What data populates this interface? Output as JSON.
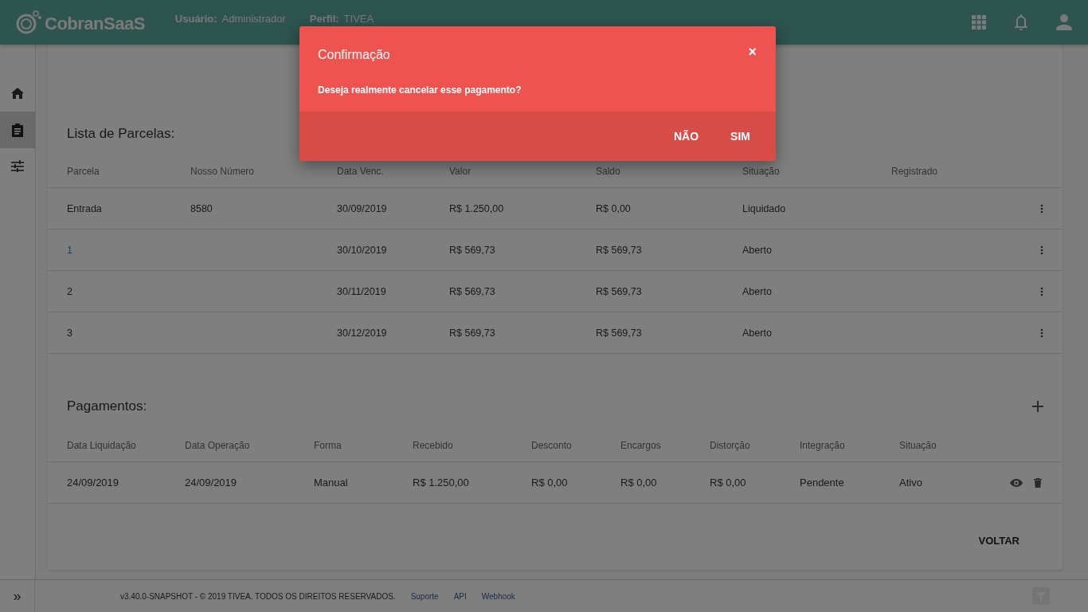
{
  "header": {
    "brand": "CobranSaaS",
    "user_label": "Usuário:",
    "user_value": "Administrador",
    "profile_label": "Perfil:",
    "profile_value": "TIVEA"
  },
  "sidebar": {
    "items": [
      {
        "selected": false
      },
      {
        "selected": true
      },
      {
        "selected": false
      }
    ]
  },
  "installments": {
    "title": "Lista de Parcelas:",
    "columns": [
      "Parcela",
      "Nosso Número",
      "Data Venc.",
      "Valor",
      "Saldo",
      "Situação",
      "Registrado"
    ],
    "rows": [
      {
        "link": false,
        "cells": [
          "Entrada",
          "8580",
          "30/09/2019",
          "R$ 1.250,00",
          "R$ 0,00",
          "Liquidado",
          ""
        ]
      },
      {
        "link": true,
        "cells": [
          "1",
          "",
          "30/10/2019",
          "R$ 569,73",
          "R$ 569,73",
          "Aberto",
          ""
        ]
      },
      {
        "link": false,
        "cells": [
          "2",
          "",
          "30/11/2019",
          "R$ 569,73",
          "R$ 569,73",
          "Aberto",
          ""
        ]
      },
      {
        "link": false,
        "cells": [
          "3",
          "",
          "30/12/2019",
          "R$ 569,73",
          "R$ 569,73",
          "Aberto",
          ""
        ]
      }
    ]
  },
  "payments": {
    "title": "Pagamentos:",
    "columns": [
      "Data Liquidação",
      "Data Operação",
      "Forma",
      "Recebido",
      "Desconto",
      "Encargos",
      "Distorção",
      "Integração",
      "Situação"
    ],
    "rows": [
      {
        "cells": [
          "24/09/2019",
          "24/09/2019",
          "Manual",
          "R$ 1.250,00",
          "R$ 0,00",
          "R$ 0,00",
          "R$ 0,00",
          "Pendente",
          "Ativo"
        ]
      }
    ]
  },
  "back_button": "VOLTAR",
  "footer": {
    "text": "v3.40.0-SNAPSHOT - © 2019 TIVEA. TODOS OS DIREITOS RESERVADOS.",
    "links": [
      "Suporte",
      "API",
      "Webhook"
    ],
    "expand": "»"
  },
  "dialog": {
    "title": "Confirmação",
    "close": "×",
    "message": "Deseja realmente cancelar esse pagamento?",
    "buttons": [
      "NÃO",
      "SIM"
    ]
  }
}
